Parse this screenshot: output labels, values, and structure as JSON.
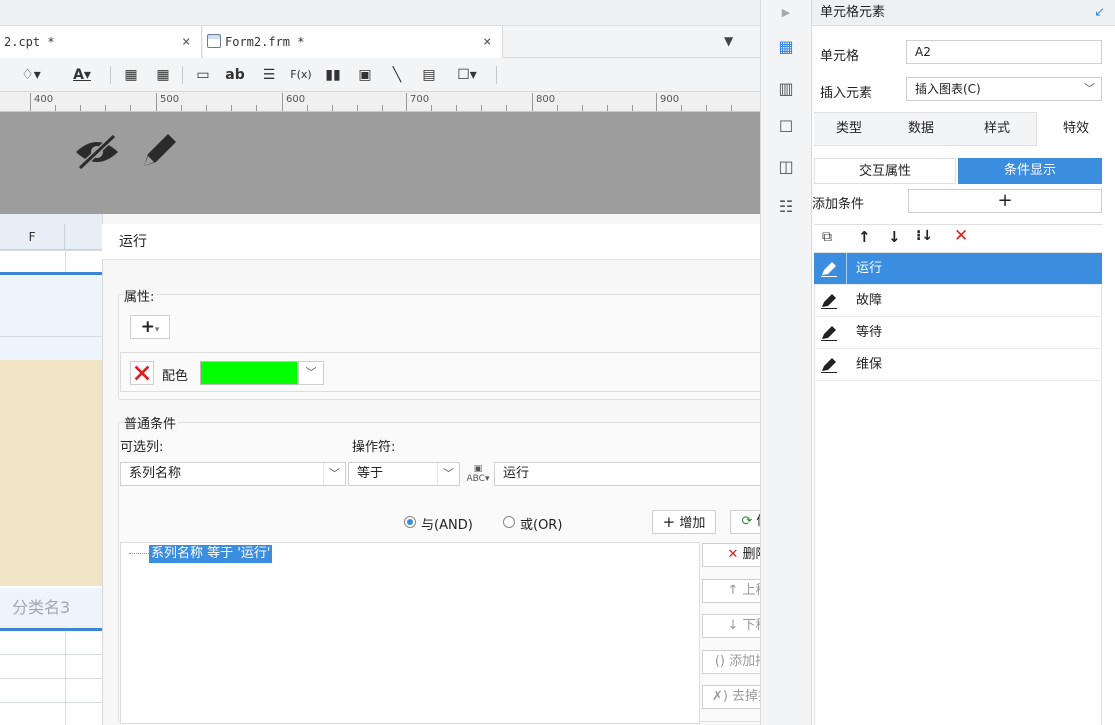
{
  "tabs": [
    {
      "label": "2.cpt *"
    },
    {
      "label": "Form2.frm *"
    }
  ],
  "toolbar": {
    "text_ab": "ab",
    "formula": "F(x)"
  },
  "ruler": {
    "marks": [
      "400",
      "500",
      "600",
      "700",
      "800",
      "900"
    ]
  },
  "sheet": {
    "column_label": "F",
    "category_label": "分类名3"
  },
  "dialog": {
    "title": "运行",
    "properties_label": "属性:",
    "color_label": "配色",
    "color_value": "#00ff00",
    "common_conditions_label": "普通条件",
    "column_label": "可选列:",
    "operator_label": "操作符:",
    "column_value": "系列名称",
    "operator_value": "等于",
    "value_input": "运行",
    "and_label": "与(AND)",
    "or_label": "或(OR)",
    "add_button": "增加",
    "modify_button": "修改",
    "condition_item": "系列名称 等于 '运行'",
    "delete_button": "删除",
    "move_up_button": "上移",
    "move_down_button": "下移",
    "add_paren_button": "添加括号",
    "remove_paren_button": "去掉括号"
  },
  "panel": {
    "title": "单元格元素",
    "cell_label": "单元格",
    "cell_value": "A2",
    "insert_label": "插入元素",
    "insert_value": "插入图表(C)",
    "tabs": [
      "类型",
      "数据",
      "样式",
      "特效"
    ],
    "subtabs": [
      "交互属性",
      "条件显示"
    ],
    "add_condition_label": "添加条件",
    "list": [
      "运行",
      "故障",
      "等待",
      "维保"
    ]
  },
  "colors": {
    "accent": "#3b8ddf",
    "delete_red": "#e02020",
    "swatch": "#00ff00"
  }
}
